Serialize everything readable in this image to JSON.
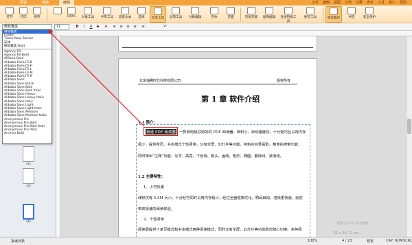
{
  "titlebar": {
    "tabs": [
      "阅读",
      "转换",
      "编辑"
    ],
    "active_tab": 2,
    "menu_right": [
      "文件",
      "编辑",
      "视图",
      "文档",
      "注释",
      "表单",
      "工具",
      "窗口",
      "帮助"
    ]
  },
  "ribbon": {
    "buttons": [
      "打开",
      "打印",
      "保存",
      "",
      "100%",
      "对象工具",
      "手形工具",
      "选取文本",
      "选择",
      "文本工具",
      "段落工具",
      "对象编辑",
      "字体",
      "页面",
      "页眉页脚",
      "图像编辑",
      "",
      "",
      "前后工具",
      "连接链接工具",
      "便签工具",
      "阅读模式",
      "书签",
      "安全保护"
    ]
  },
  "formatbar": {
    "font_value": "微软雅黑",
    "size_value": "11",
    "buttons": [
      "B",
      "I",
      "U",
      "S",
      "A",
      "≡",
      "≡",
      "≡",
      "≡",
      "≡",
      "↶"
    ]
  },
  "font_dropdown": {
    "recent": [
      "微软雅黑",
      "Calibri",
      "Times New Roman",
      "宋体",
      "微软雅黑 Bold"
    ],
    "all": [
      "Agency FB",
      "Agency FB Bold",
      "AlDeep Bold",
      "Alibaba-PuHuiTi-B",
      "Alibaba-PuHuiTi-H",
      "Alibaba-PuHuiTi-L",
      "Alibaba-PuHuiTi-M",
      "Alibaba-PuHuiTi-R",
      "Alibaba Sans",
      "Alibaba Sans Black",
      "Alibaba Sans Bold",
      "Alibaba Sans Bold Italic",
      "Alibaba Sans Heavy",
      "Alibaba Sans Heavy Italic",
      "Alibaba Sans Italic",
      "Alibaba Sans Light",
      "Alibaba Sans Light Italic",
      "Alibaba Sans Medium",
      "Alibaba Sans Medium Italic",
      "Anonymous Pro",
      "Anonymous Pro Bold",
      "Anonymous Pro Bold Italic",
      "Anonymous Pro Italic",
      "Archivo Bold"
    ]
  },
  "thumbnails": {
    "labels": [
      "(2)",
      "(3)",
      "(4)"
    ]
  },
  "document": {
    "header_left": "北京海腾时代科技有限公司",
    "header_right": "版权所有",
    "chapter_title": "第 1 章 软件介绍",
    "sec1": "1.1 简介：",
    "highlight": "极速 PDF 阅读器",
    "para1_rest": "一款阅电极好用的的 PDF 阅读器，体积小、启动速度快，十分轻巧且占用内存",
    "para1_l2": "极少，提供单页、书本模式个性阅读，又有全屏、幻灯片等功能，特色的目录提取，精准的搜索功能；",
    "para1_l3": "同时推出“注释”功能：写字、高亮、下划线、箭头、画线、矩形、椭圆、删除线、波浪线。",
    "sec2": "1.2 主要特性：",
    "item1": "1、小巧快速",
    "item1_text": "体积仅有 5.4M 大小，十分轻巧同时占用内存极少；经过全面框架优化，瞬间启动，渲染更快速，给您",
    "item1_text2": "带来极速的阅读体验。",
    "item2": "2、个性阅读",
    "item2_text": "阅读器提供了单页模式和书本模式两种阅读模式，同时又有全屏、幻灯片等功能助您随心切换。多种阅"
  },
  "status": {
    "left": "净读列表",
    "zoom": "100%",
    "page": "4 / 23",
    "dims": "21 x 29.71 cm",
    "mode": "预览",
    "keys": [
      "CAP",
      "NUM",
      "SCRL"
    ]
  },
  "watermark": "微信公众号 PDF教程"
}
